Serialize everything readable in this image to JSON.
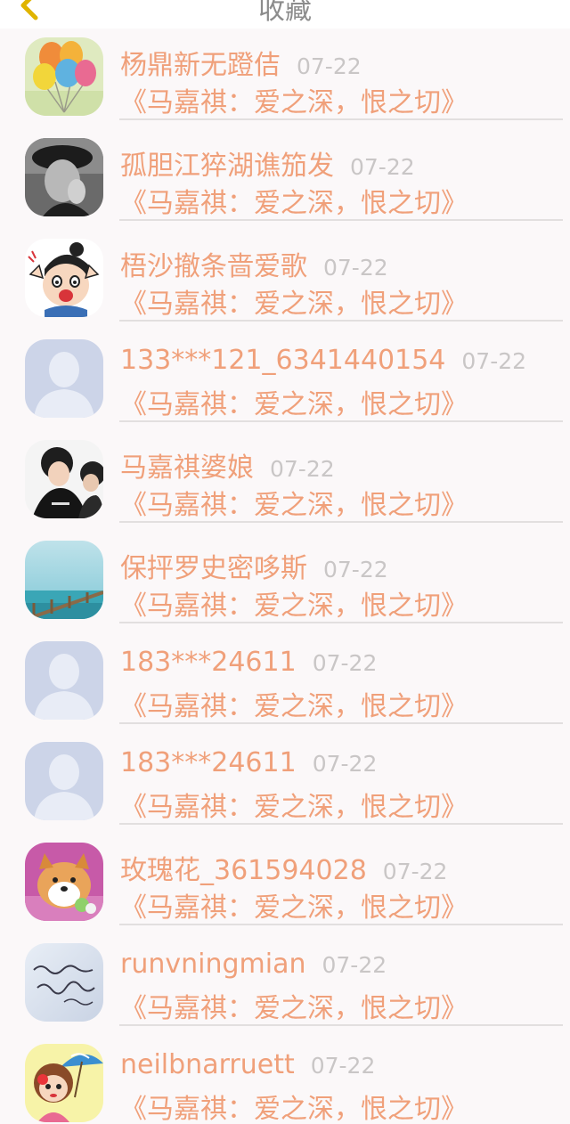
{
  "header": {
    "title": "收藏",
    "back_icon": "chevron-left-icon",
    "accent": "#f2c200"
  },
  "colors": {
    "name": "#f0a07a",
    "date": "#c9c6c6",
    "background": "#fbf8f9",
    "divider": "#e2dfdf"
  },
  "items": [
    {
      "name": "杨鼎新无蹬佶",
      "date": "07-22",
      "title": "《马嘉祺：爱之深，恨之切》",
      "avatar": "balloons-avatar"
    },
    {
      "name": "孤胆江猝湖谯笳发",
      "date": "07-22",
      "title": "《马嘉祺：爱之深，恨之切》",
      "avatar": "bw-person-avatar"
    },
    {
      "name": "梧沙撤条啬爱歌",
      "date": "07-22",
      "title": "《马嘉祺：爱之深，恨之切》",
      "avatar": "cartoon-boy-avatar"
    },
    {
      "name": "133***121_6341440154",
      "date": "07-22",
      "title": "《马嘉祺：爱之深，恨之切》",
      "avatar": "default-avatar"
    },
    {
      "name": "马嘉祺婆娘",
      "date": "07-22",
      "title": "《马嘉祺：爱之深，恨之切》",
      "avatar": "photo-people-avatar"
    },
    {
      "name": "保抨罗史密哆斯",
      "date": "07-22",
      "title": "《马嘉祺：爱之深，恨之切》",
      "avatar": "sea-avatar"
    },
    {
      "name": "183***24611",
      "date": "07-22",
      "title": "《马嘉祺：爱之深，恨之切》",
      "avatar": "default-avatar"
    },
    {
      "name": "183***24611",
      "date": "07-22",
      "title": "《马嘉祺：爱之深，恨之切》",
      "avatar": "default-avatar"
    },
    {
      "name": "玫瑰花_361594028",
      "date": "07-22",
      "title": "《马嘉祺：爱之深，恨之切》",
      "avatar": "dog-avatar"
    },
    {
      "name": "runvningmian",
      "date": "07-22",
      "title": "《马嘉祺：爱之深，恨之切》",
      "avatar": "handwriting-avatar"
    },
    {
      "name": "neilbnarruett",
      "date": "07-22",
      "title": "《马嘉祺：爱之深，恨之切》",
      "avatar": "umbrella-girl-avatar"
    }
  ]
}
